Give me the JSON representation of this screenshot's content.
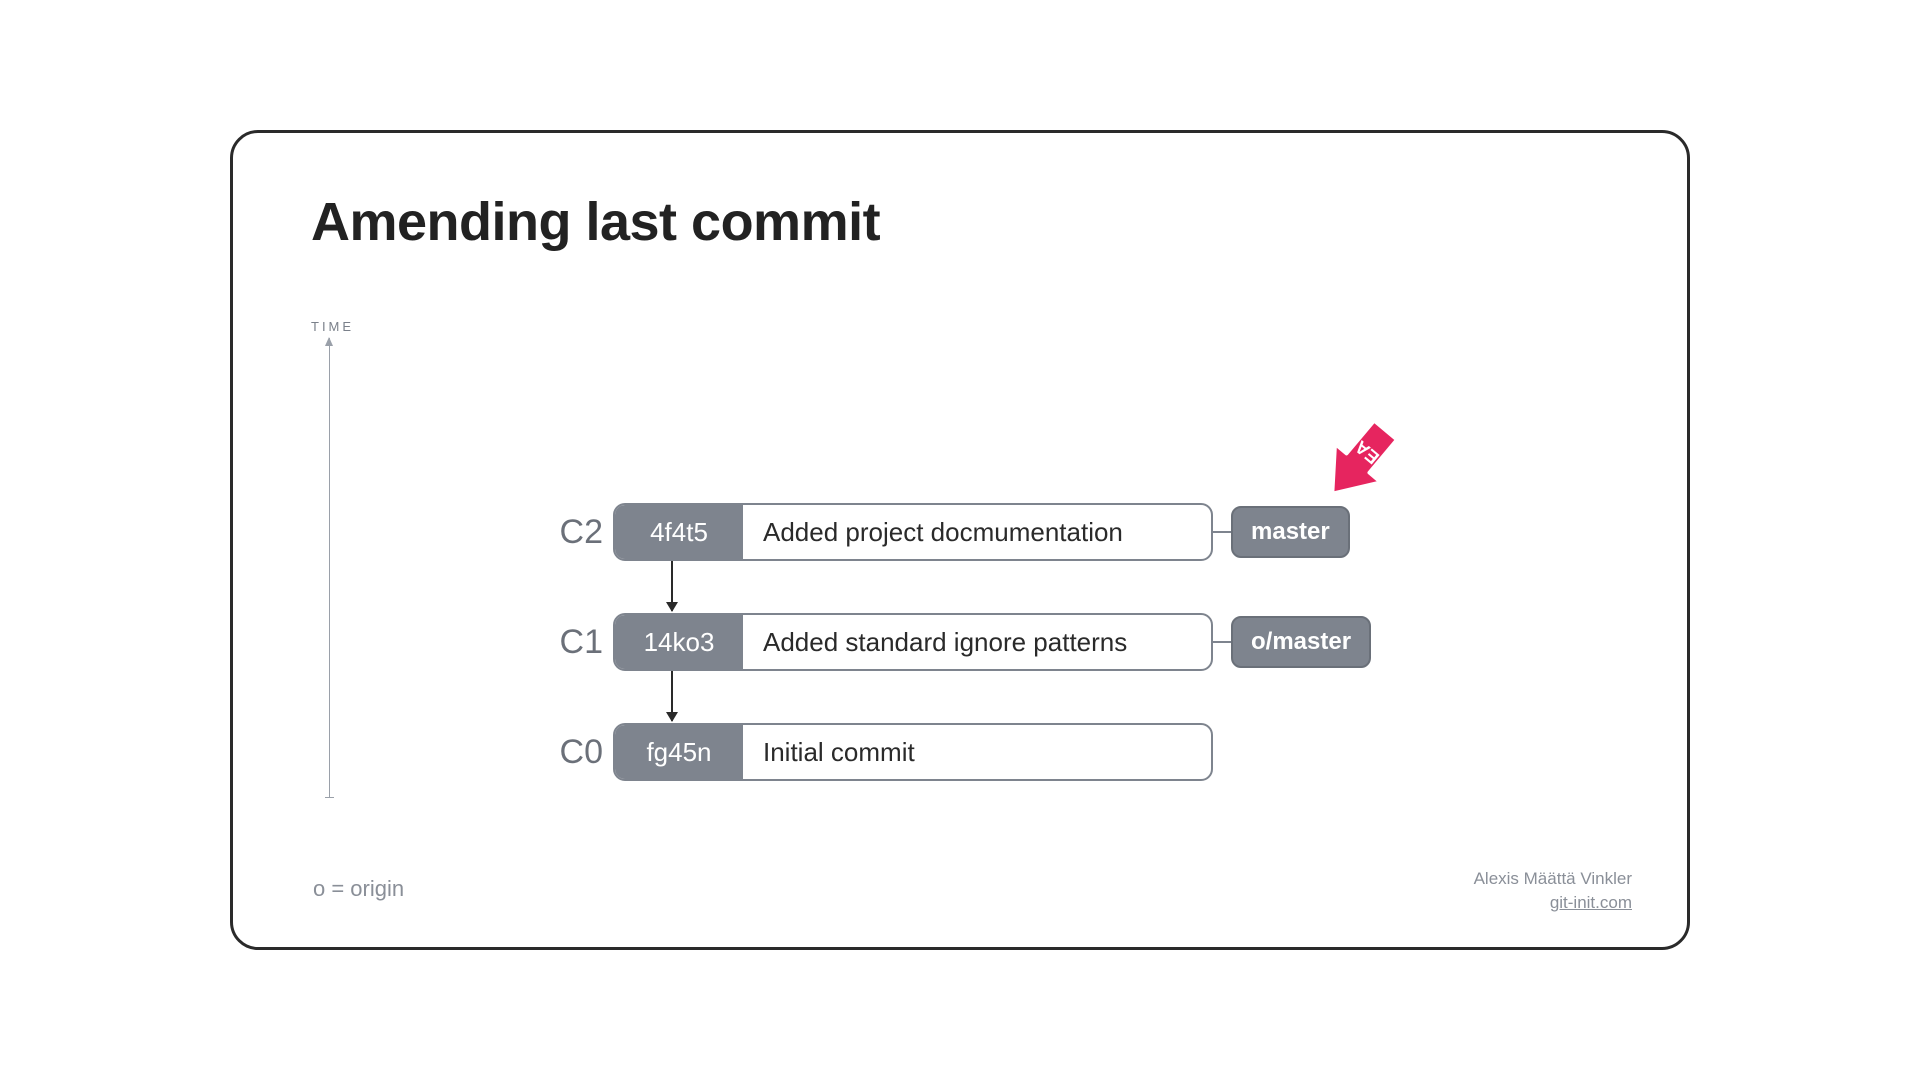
{
  "title": "Amending last commit",
  "time_label": "TIME",
  "commits": [
    {
      "label": "C2",
      "hash": "4f4t5",
      "message": "Added project docmumentation",
      "branch": "master"
    },
    {
      "label": "C1",
      "hash": "14ko3",
      "message": "Added standard ignore patterns",
      "branch": "o/master"
    },
    {
      "label": "C0",
      "hash": "fg45n",
      "message": "Initial commit",
      "branch": null
    }
  ],
  "head_label": "HEAD",
  "footer": {
    "legend": "o = origin",
    "author": "Alexis Määttä Vinkler",
    "site": "git-init.com"
  }
}
